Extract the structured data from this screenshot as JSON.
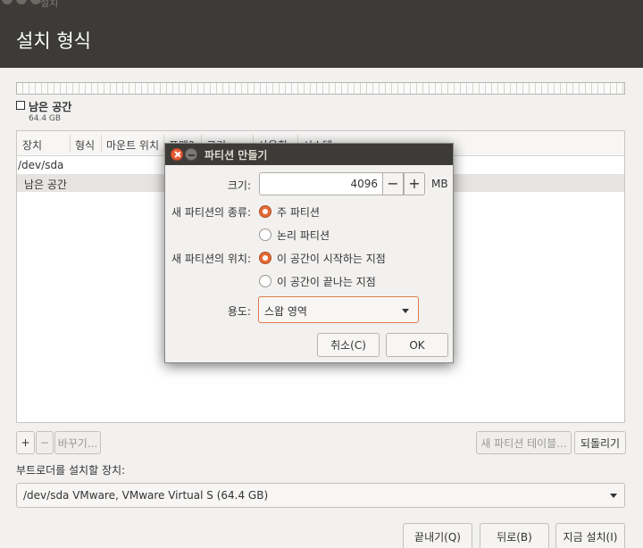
{
  "window": {
    "title": "설치"
  },
  "page": {
    "title": "설치 형식"
  },
  "disk": {
    "legend_label": "남은 공간",
    "legend_size": "64.4 GB"
  },
  "table": {
    "columns": [
      "장치",
      "형식",
      "마운트 위치",
      "포맷?",
      "크기",
      "사용함",
      "시스템"
    ],
    "rows": [
      {
        "device": "/dev/sda"
      },
      {
        "device": "남은 공간"
      }
    ]
  },
  "toolbar": {
    "add": "+",
    "remove": "−",
    "change": "바꾸기...",
    "new_table": "새 파티션 테이블...",
    "revert": "되돌리기"
  },
  "bootloader": {
    "label": "부트로더를 설치할 장치:",
    "value": "/dev/sda VMware, VMware Virtual S (64.4 GB)"
  },
  "buttons": {
    "quit": "끝내기(Q)",
    "back": "뒤로(B)",
    "install": "지금 설치(I)"
  },
  "dialog": {
    "title": "파티션 만들기",
    "size_label": "크기:",
    "size_value": "4096",
    "minus": "−",
    "plus": "+",
    "size_unit": "MB",
    "type_label": "새 파티션의 종류:",
    "type_options": [
      "주 파티션",
      "논리 파티션"
    ],
    "type_selected": 0,
    "location_label": "새 파티션의 위치:",
    "location_options": [
      "이 공간이 시작하는 지점",
      "이 공간이 끝나는 지점"
    ],
    "location_selected": 0,
    "use_label": "용도:",
    "use_value": "스왑 영역",
    "cancel": "취소(C)",
    "ok": "OK"
  }
}
